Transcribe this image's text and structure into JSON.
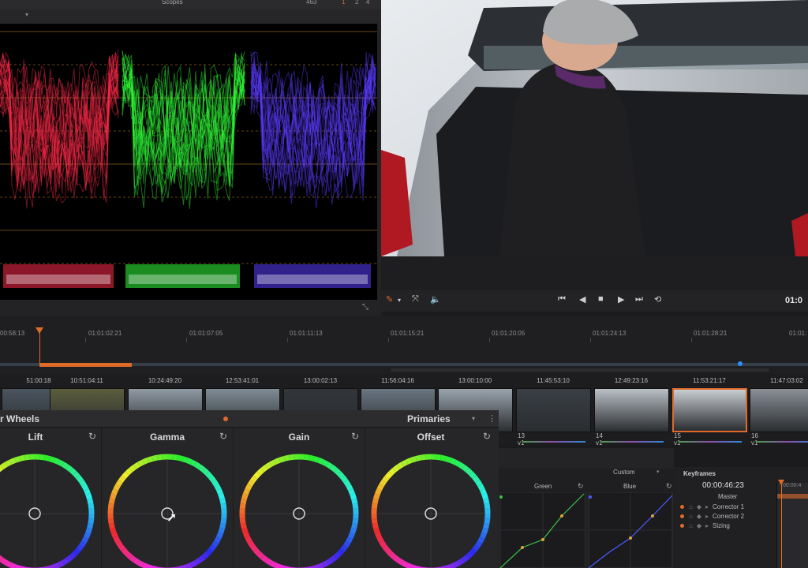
{
  "scopes": {
    "title": "Scopes",
    "count": "463",
    "options": [
      "1",
      "2",
      "4"
    ],
    "parade_colors": {
      "red": "#ff2a4a",
      "green": "#30ff3a",
      "blue": "#5a3cff"
    }
  },
  "viewer": {
    "timecode": "01:0"
  },
  "timeline": {
    "ruler_labels": [
      "00:58:13",
      "01:01:02:21",
      "01:01:07:05",
      "01:01:11:13",
      "01:01:15:21",
      "01:01:20:05",
      "01:01:24:13",
      "01:01:28:21",
      "01:01:"
    ],
    "accent_color": "#e06a2a"
  },
  "clips": [
    {
      "tc": "51:00:18",
      "label": ""
    },
    {
      "tc": "10:51:04:11",
      "label": ""
    },
    {
      "tc": "10:24:49:20",
      "label": ""
    },
    {
      "tc": "12:53:41:01",
      "label": ""
    },
    {
      "tc": "13:00:02:13",
      "label": ""
    },
    {
      "tc": "11:56:04:16",
      "label": ""
    },
    {
      "tc": "13:00:10:00",
      "label": ""
    },
    {
      "tc": "11:45:53:10",
      "label": "13  v1"
    },
    {
      "tc": "12:49:23:16",
      "label": "14  v1"
    },
    {
      "tc": "11:53:21:17",
      "label": "15  v1"
    },
    {
      "tc": "11:47:03:02",
      "label": "16  v1"
    }
  ],
  "wheels": {
    "title": "r Wheels",
    "mode": "Primaries",
    "items": [
      {
        "label": "Lift"
      },
      {
        "label": "Gamma"
      },
      {
        "label": "Gain"
      },
      {
        "label": "Offset"
      }
    ]
  },
  "curves": {
    "preset": "Custom",
    "green_label": "Green",
    "blue_label": "Blue"
  },
  "keyframes": {
    "title": "Keyframes",
    "timecode": "00:00:46:23",
    "timecode_right": "00:00:4",
    "master": "Master",
    "rows": [
      "Corrector 1",
      "Corrector 2",
      "Sizing"
    ]
  }
}
